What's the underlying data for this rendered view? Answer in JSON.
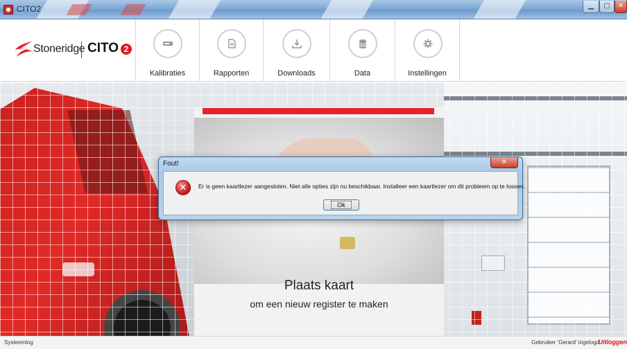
{
  "window": {
    "title": "CITO2"
  },
  "logo": {
    "brand": "Stoneridge",
    "product": "CITO",
    "product_suffix": "2"
  },
  "nav": {
    "items": [
      {
        "label": "Kalibraties",
        "icon": "card-reader-icon"
      },
      {
        "label": "Rapporten",
        "icon": "document-icon"
      },
      {
        "label": "Downloads",
        "icon": "download-icon"
      },
      {
        "label": "Data",
        "icon": "database-icon"
      },
      {
        "label": "Instellingen",
        "icon": "gear-icon"
      }
    ]
  },
  "card": {
    "title": "Plaats kaart",
    "subtitle": "om een nieuw register te maken"
  },
  "dialog": {
    "title": "Fout!",
    "message": "Er is geen kaartlezer aangesloten. Niet alle opties zijn nu beschikbaar. Installeer een kaartlezer om dit probleem op te lossen.",
    "ok_label": "Ok"
  },
  "status": {
    "left": "Systeemlog",
    "user": "Gebruiker 'Gerard' ingelogd",
    "logout": "Uitloggen"
  },
  "colors": {
    "accent": "#e2232a",
    "dialog_frame": "#aac8e8"
  }
}
